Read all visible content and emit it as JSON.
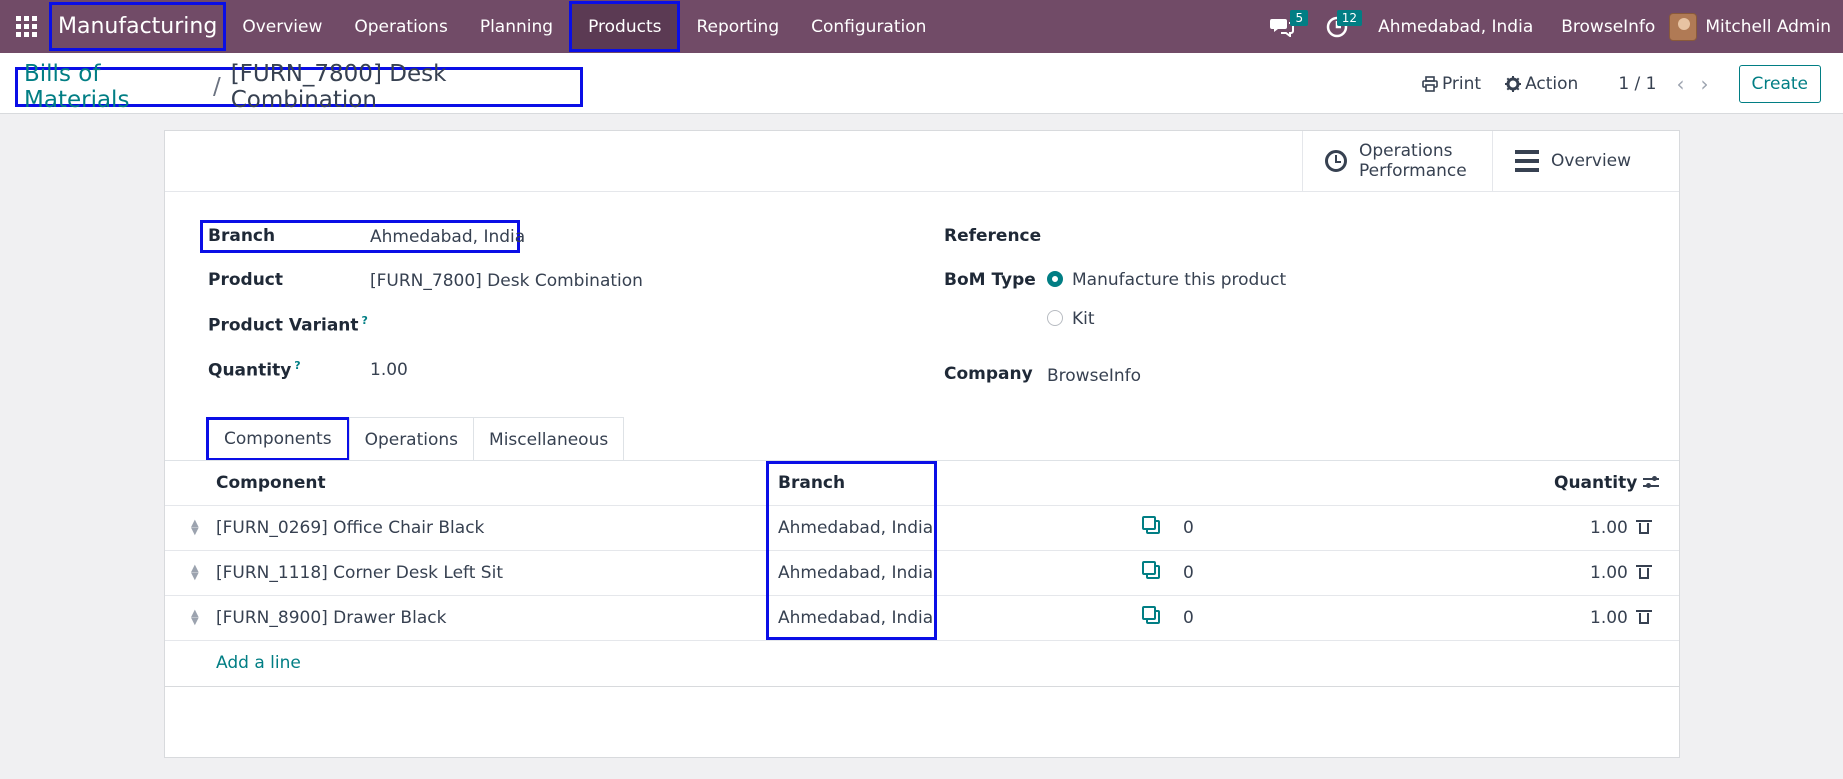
{
  "navbar": {
    "brand": "Manufacturing",
    "menu": [
      "Overview",
      "Operations",
      "Planning",
      "Products",
      "Reporting",
      "Configuration"
    ],
    "messages_count": "5",
    "activities_count": "12",
    "branch": "Ahmedabad, India",
    "company": "BrowseInfo",
    "user": "Mitchell Admin"
  },
  "control_panel": {
    "breadcrumb_parent": "Bills of Materials",
    "breadcrumb_separator": "/",
    "breadcrumb_current": "[FURN_7800] Desk Combination",
    "print_label": "Print",
    "action_label": "Action",
    "pager": "1 / 1",
    "create_label": "Create"
  },
  "stat_buttons": {
    "operations_performance_line1": "Operations",
    "operations_performance_line2": "Performance",
    "overview": "Overview"
  },
  "form": {
    "branch_label": "Branch",
    "branch_value": "Ahmedabad, India",
    "product_label": "Product",
    "product_value": "[FURN_7800] Desk Combination",
    "product_variant_label": "Product Variant",
    "quantity_label": "Quantity",
    "quantity_value": "1.00",
    "help_mark": "?",
    "reference_label": "Reference",
    "bom_type_label": "BoM Type",
    "bom_type_options": [
      "Manufacture this product",
      "Kit"
    ],
    "bom_type_selected": "Manufacture this product",
    "company_label": "Company",
    "company_value": "BrowseInfo"
  },
  "tabs": [
    "Components",
    "Operations",
    "Miscellaneous"
  ],
  "components_table": {
    "headers": {
      "component": "Component",
      "branch": "Branch",
      "quantity": "Quantity"
    },
    "rows": [
      {
        "component": "[FURN_0269] Office Chair Black",
        "branch": "Ahmedabad, India",
        "count": "0",
        "quantity": "1.00"
      },
      {
        "component": "[FURN_1118] Corner Desk Left Sit",
        "branch": "Ahmedabad, India",
        "count": "0",
        "quantity": "1.00"
      },
      {
        "component": "[FURN_8900] Drawer Black",
        "branch": "Ahmedabad, India",
        "count": "0",
        "quantity": "1.00"
      }
    ],
    "add_line_label": "Add a line"
  },
  "colors": {
    "navbar": "#714b67",
    "accent": "#017e84",
    "highlight_box": "#0a0ee6"
  }
}
